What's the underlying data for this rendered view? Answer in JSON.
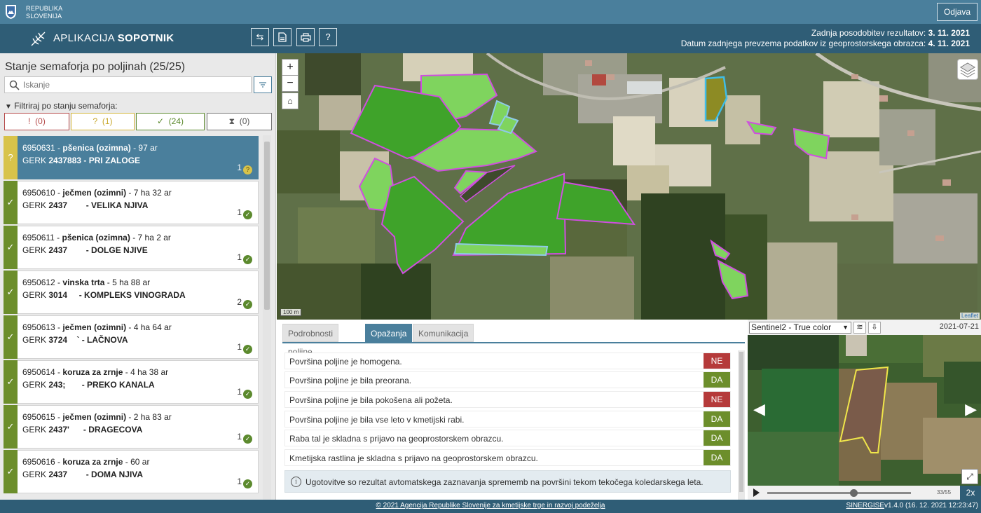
{
  "topbar": {
    "org_line1": "REPUBLIKA",
    "org_line2": "SLOVENIJA",
    "logout_label": "Odjava"
  },
  "appbar": {
    "title_normal": "APLIKACIJA ",
    "title_bold": "SOPOTNIK",
    "update_label": "Zadnja posodobitev rezultatov:",
    "update_date": "3. 11. 2021",
    "import_label": "Datum zadnjega prevzema podatkov iz geoprostorskega obrazca:",
    "import_date": "4. 11. 2021"
  },
  "sidebar": {
    "title": "Stanje semaforja po poljinah (25/25)",
    "search_placeholder": "Iskanje",
    "filter_label": "Filtriraj po stanju semaforja:",
    "filters": [
      {
        "symbol": "!",
        "count": "(0)"
      },
      {
        "symbol": "?",
        "count": "(1)"
      },
      {
        "symbol": "✓",
        "count": "(24)"
      },
      {
        "symbol": "⧗",
        "count": "(0)"
      }
    ],
    "items": [
      {
        "status": "?",
        "id": "6950631 - ",
        "crop": "pšenica (ozimna)",
        "area": " - 97 ar",
        "gerk_prefix": "GERK ",
        "gerk": "2437883",
        "name": " - PRI ZALOGE",
        "count": "1",
        "badge": "?"
      },
      {
        "status": "✓",
        "id": "6950610 - ",
        "crop": "ječmen (ozimni)",
        "area": " - 7 ha 32 ar",
        "gerk_prefix": "GERK ",
        "gerk": "2437",
        "name": "        - VELIKA NJIVA",
        "count": "1",
        "badge": "✓"
      },
      {
        "status": "✓",
        "id": "6950611 - ",
        "crop": "pšenica (ozimna)",
        "area": " - 7 ha 2 ar",
        "gerk_prefix": "GERK ",
        "gerk": "2437",
        "name": "        - DOLGE NJIVE",
        "count": "1",
        "badge": "✓"
      },
      {
        "status": "✓",
        "id": "6950612 - ",
        "crop": "vinska trta",
        "area": " - 5 ha 88 ar",
        "gerk_prefix": "GERK ",
        "gerk": "3014",
        "name": "     - KOMPLEKS VINOGRADA",
        "count": "2",
        "badge": "✓"
      },
      {
        "status": "✓",
        "id": "6950613 - ",
        "crop": "ječmen (ozimni)",
        "area": " - 4 ha 64 ar",
        "gerk_prefix": "GERK ",
        "gerk": "3724",
        "name": "    ` - LAČNOVA",
        "count": "1",
        "badge": "✓"
      },
      {
        "status": "✓",
        "id": "6950614 - ",
        "crop": "koruza za zrnje",
        "area": " - 4 ha 38 ar",
        "gerk_prefix": "GERK ",
        "gerk": "243;",
        "name": "       - PREKO KANALA",
        "count": "1",
        "badge": "✓"
      },
      {
        "status": "✓",
        "id": "6950615 - ",
        "crop": "ječmen (ozimni)",
        "area": " - 2 ha 83 ar",
        "gerk_prefix": "GERK ",
        "gerk": "2437'",
        "name": "      - DRAGECOVA",
        "count": "1",
        "badge": "✓"
      },
      {
        "status": "✓",
        "id": "6950616 - ",
        "crop": "koruza za zrnje",
        "area": " - 60 ar",
        "gerk_prefix": "GERK ",
        "gerk": "2437",
        "name": "        - DOMA NJIVA",
        "count": "1",
        "badge": "✓"
      }
    ]
  },
  "map": {
    "zoom_in": "+",
    "zoom_out": "−",
    "scale_label": "100 m",
    "attribution": "Leaflet"
  },
  "details": {
    "tabs": [
      "Podrobnosti poljine",
      "Opažanja",
      "Komunikacija"
    ],
    "active_tab": 1,
    "observations": [
      {
        "text": "Površina poljine je homogena.",
        "value": "NE"
      },
      {
        "text": "Površina poljine je bila preorana.",
        "value": "DA"
      },
      {
        "text": "Površina poljine je bila pokošena ali požeta.",
        "value": "NE"
      },
      {
        "text": "Površina poljine je bila vse leto v kmetijski rabi.",
        "value": "DA"
      },
      {
        "text": "Raba tal je skladna s prijavo na geoprostorskem obrazcu.",
        "value": "DA"
      },
      {
        "text": "Kmetijska rastlina je skladna s prijavo na geoprostorskem obrazcu.",
        "value": "DA"
      }
    ],
    "info_text": "Ugotovitve so rezultat avtomatskega zaznavanja sprememb na površini tekom tekočega koledarskega leta."
  },
  "satellite": {
    "layer": "Sentinel2 - True color",
    "date": "2021-07-21",
    "frame": "33/55",
    "frame_progress": 0.6,
    "speed": "2x"
  },
  "footer": {
    "copyright": "© 2021 Agencija Republike Slovenije za kmetijske trge in razvoj podeželja",
    "vendor": "SINERGISE",
    "version": "v1.4.0 (16. 12. 2021 12:23:47)"
  },
  "colors": {
    "header": "#4a7f9c",
    "header_dark": "#2f5d76",
    "ok_green": "#6c8e2b",
    "warn_yellow": "#d8c34a",
    "no_red": "#b53a3a"
  }
}
